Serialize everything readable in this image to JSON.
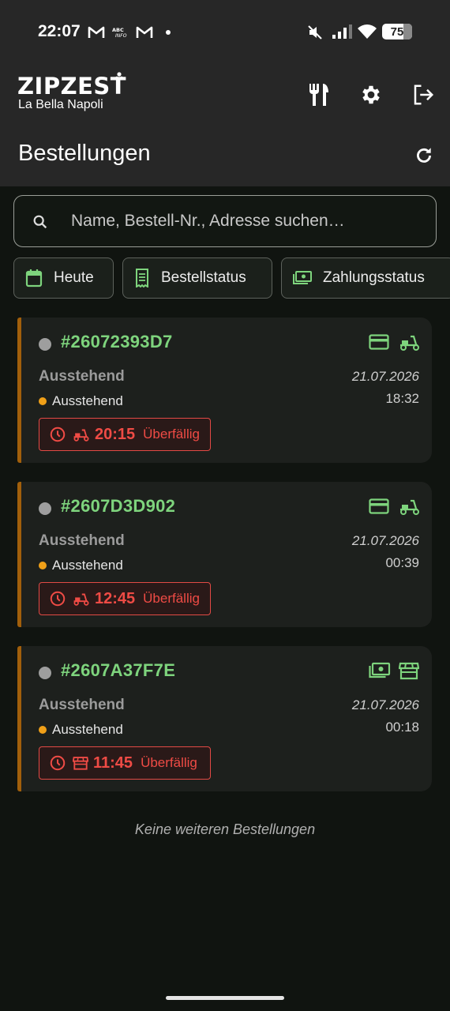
{
  "status_bar": {
    "time": "22:07",
    "battery": "75",
    "icons": [
      "gmail-icon",
      "abc-news-icon",
      "gmail-icon",
      "dot-icon",
      "mute-icon",
      "signal-icon",
      "wifi-icon",
      "battery-icon"
    ]
  },
  "header": {
    "brand": "ZIPZEST",
    "restaurant": "La Bella Napoli",
    "title": "Bestellungen",
    "actions": [
      "restaurant-menu-icon",
      "settings-icon",
      "logout-icon",
      "refresh-icon"
    ]
  },
  "search": {
    "placeholder": "Name, Bestell-Nr., Adresse suchen…"
  },
  "filters": {
    "date": "Heute",
    "order_status": "Bestellstatus",
    "payment_status": "Zahlungsstatus"
  },
  "orders": [
    {
      "id": "#26072393D7",
      "status": "Ausstehend",
      "sub_status": "Ausstehend",
      "date": "21.07.2026",
      "time": "18:32",
      "due_time": "20:15",
      "due_label": "Überfällig",
      "payment": "card-icon",
      "type": "delivery-scooter-icon"
    },
    {
      "id": "#2607D3D902",
      "status": "Ausstehend",
      "sub_status": "Ausstehend",
      "date": "21.07.2026",
      "time": "00:39",
      "due_time": "12:45",
      "due_label": "Überfällig",
      "payment": "card-icon",
      "type": "delivery-scooter-icon"
    },
    {
      "id": "#2607A37F7E",
      "status": "Ausstehend",
      "sub_status": "Ausstehend",
      "date": "21.07.2026",
      "time": "00:18",
      "due_time": "11:45",
      "due_label": "Überfällig",
      "payment": "cash-icon",
      "type": "pickup-store-icon"
    }
  ],
  "footer_note": "Keine weiteren Bestellungen",
  "colors": {
    "accent_green": "#7ed47d",
    "overdue_red": "#ef4b45",
    "pending_orange": "#f0a018",
    "card_bar": "#a15f0b"
  }
}
